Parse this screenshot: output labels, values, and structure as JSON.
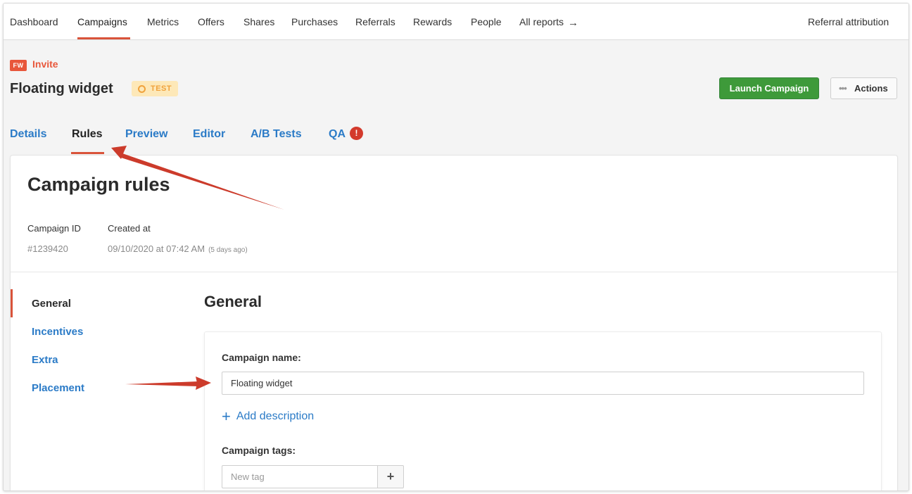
{
  "topnav": {
    "items": [
      "Dashboard",
      "Campaigns",
      "Metrics",
      "Offers",
      "Shares",
      "Purchases",
      "Referrals",
      "Rewards",
      "People",
      "All reports"
    ],
    "active": "Campaigns",
    "right_link": "Referral attribution"
  },
  "header": {
    "brand_badge": "FW",
    "brand_label": "Invite",
    "title": "Floating widget",
    "status": "TEST",
    "launch_label": "Launch Campaign",
    "actions_label": "Actions"
  },
  "tabs": {
    "items": [
      "Details",
      "Rules",
      "Preview",
      "Editor",
      "A/B Tests",
      "QA"
    ],
    "active": "Rules",
    "qa_alert": "!"
  },
  "card": {
    "title": "Campaign rules",
    "id_label": "Campaign ID",
    "id_value": "#1239420",
    "created_label": "Created at",
    "created_value": "09/10/2020 at 07:42 AM",
    "created_relative": "(5 days ago)"
  },
  "sidenav": {
    "items": [
      "General",
      "Incentives",
      "Extra",
      "Placement"
    ],
    "active": "General"
  },
  "section": {
    "title": "General",
    "name_label": "Campaign name:",
    "name_value": "Floating widget",
    "add_description": "Add description",
    "tags_label": "Campaign tags:",
    "tags_placeholder": "New tag"
  },
  "colors": {
    "accent": "#d9533a",
    "link": "#2b7bc7",
    "launch": "#3e9a3a",
    "status_bg": "#fde8b8",
    "status_text": "#f0a23c",
    "annotation_arrow": "#cc3b2b"
  }
}
